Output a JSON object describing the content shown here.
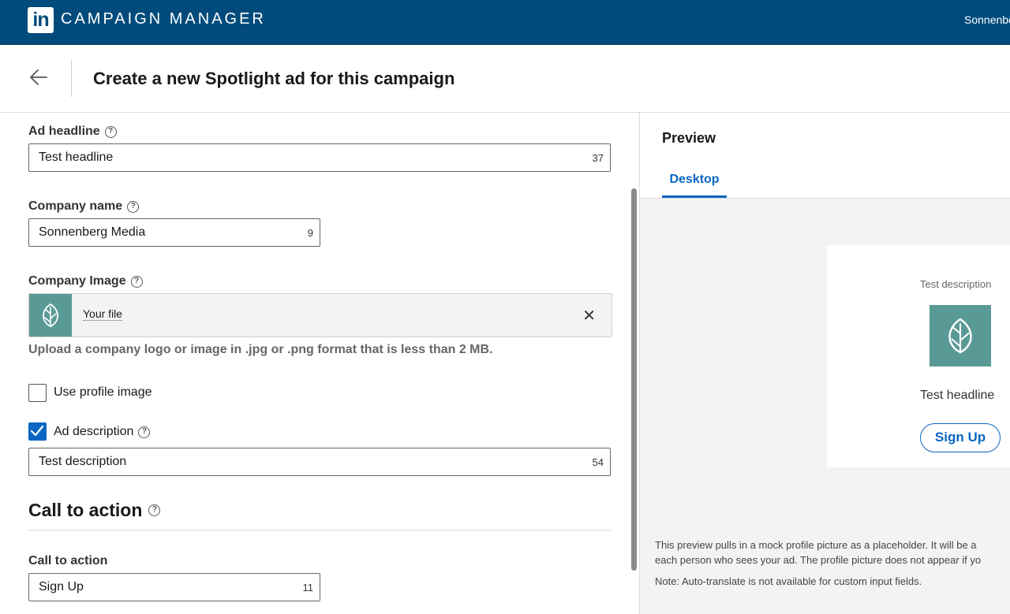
{
  "topbar": {
    "logo_text": "in",
    "app_title": "CAMPAIGN MANAGER",
    "user": "Sonnenberg"
  },
  "header": {
    "back_icon": "arrow-left-icon",
    "title": "Create a new Spotlight ad for this campaign"
  },
  "form": {
    "ad_headline": {
      "label": "Ad headline",
      "value": "Test headline",
      "count": "37"
    },
    "company_name": {
      "label": "Company name",
      "value": "Sonnenberg Media",
      "count": "9"
    },
    "company_image": {
      "label": "Company Image",
      "file_name": "Your file",
      "hint": "Upload a company logo or image in .jpg or .png format that is less than 2 MB."
    },
    "use_profile_image": {
      "label": "Use profile image",
      "checked": false
    },
    "ad_description": {
      "label": "Ad description",
      "checked": true,
      "value": "Test description",
      "count": "54"
    },
    "cta_section": {
      "title": "Call to action"
    },
    "call_to_action": {
      "label": "Call to action",
      "value": "Sign Up",
      "count": "11"
    }
  },
  "preview": {
    "title": "Preview",
    "tab": "Desktop",
    "card": {
      "description": "Test description",
      "headline": "Test headline",
      "cta": "Sign Up"
    },
    "note_line1": "This preview pulls in a mock profile picture as a placeholder. It will be a",
    "note_line2": "each person who sees your ad. The profile picture does not appear if yo",
    "note_line3": "Note: Auto-translate is not available for custom input fields."
  },
  "colors": {
    "brand": "#004b7c",
    "accent": "#0a66c2",
    "logo_tile": "#5a9a96"
  }
}
